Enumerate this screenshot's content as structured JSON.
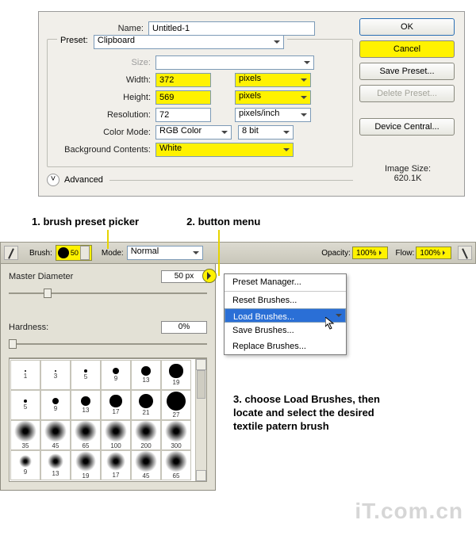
{
  "dialog": {
    "labels": {
      "name": "Name:",
      "preset": "Preset:",
      "size": "Size:",
      "width": "Width:",
      "height": "Height:",
      "resolution": "Resolution:",
      "colorMode": "Color Mode:",
      "bgContents": "Background Contents:",
      "imageSize": "Image Size:"
    },
    "values": {
      "name": "Untitled-1",
      "preset": "Clipboard",
      "width": "372",
      "height": "569",
      "resolution": "72",
      "colorMode": "RGB Color",
      "bitDepth": "8 bit",
      "bgContents": "White",
      "units": "pixels",
      "resUnits": "pixels/inch",
      "imageSizeValue": "620.1K"
    },
    "buttons": {
      "ok": "OK",
      "cancel": "Cancel",
      "savePreset": "Save Preset...",
      "deletePreset": "Delete Preset...",
      "deviceCentral": "Device Central..."
    },
    "advanced": "Advanced"
  },
  "callouts": {
    "c1": "1. brush preset picker",
    "c2": "2. button menu",
    "c3": "3. choose Load Brushes, then locate and select the desired textile patern brush"
  },
  "optbar": {
    "brushLabel": "Brush:",
    "brushSize": "50",
    "modeLabel": "Mode:",
    "modeValue": "Normal",
    "opacityLabel": "Opacity:",
    "opacityValue": "100%",
    "flowLabel": "Flow:",
    "flowValue": "100%"
  },
  "panel": {
    "masterDiameter": "Master Diameter",
    "masterValue": "50 px",
    "hardness": "Hardness:",
    "hardnessValue": "0%"
  },
  "menu": {
    "presetManager": "Preset Manager...",
    "resetBrushes": "Reset Brushes...",
    "loadBrushes": "Load Brushes...",
    "saveBrushes": "Save Brushes...",
    "replaceBrushes": "Replace Brushes..."
  },
  "brush_presets": [
    [
      1,
      3,
      5,
      9,
      13,
      19
    ],
    [
      5,
      9,
      13,
      17,
      21,
      27
    ],
    [
      35,
      45,
      65,
      100,
      200,
      300
    ],
    [
      9,
      13,
      19,
      17,
      45,
      65
    ]
  ],
  "watermark": "iT.com.cn"
}
